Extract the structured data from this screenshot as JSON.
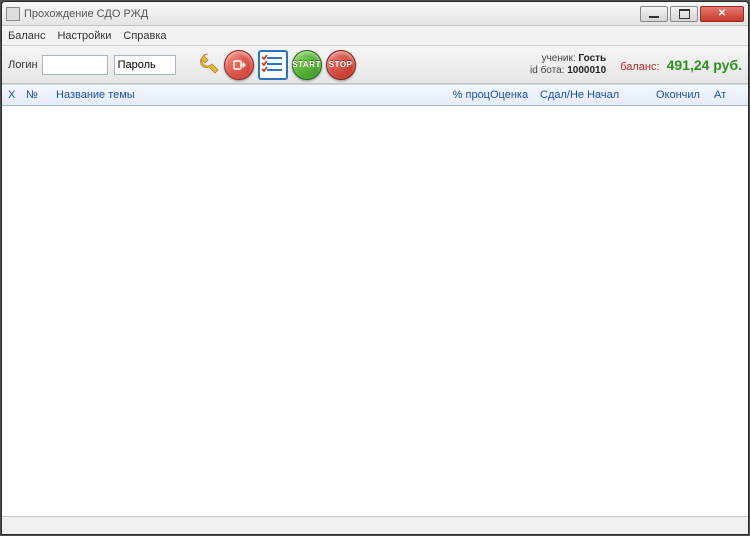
{
  "window": {
    "title": "Прохождение СДО РЖД"
  },
  "menu": {
    "balance": "Баланс",
    "settings": "Настройки",
    "help": "Справка"
  },
  "toolbar": {
    "login_label": "Логин",
    "password_label": "Пароль",
    "login_value": "",
    "password_value": "Пароль",
    "icons": {
      "wrench": "wrench-icon",
      "power": "power-icon",
      "checklist": "checklist-icon",
      "start": "start-icon",
      "stop": "stop-icon"
    },
    "start_text": "START",
    "stop_text": "STOP"
  },
  "info": {
    "student_label": "ученик:",
    "student_value": "Гость",
    "bot_label": "id бота:",
    "bot_value": "1000010",
    "balance_label": "баланс:",
    "balance_value": "491,24 руб."
  },
  "columns": {
    "x": "X",
    "no": "№",
    "name": "Название темы",
    "perc": "% проц",
    "grade": "Оценка",
    "pass": "Сдал/Не Начал",
    "finish": "Окончил",
    "att": "Ат"
  }
}
